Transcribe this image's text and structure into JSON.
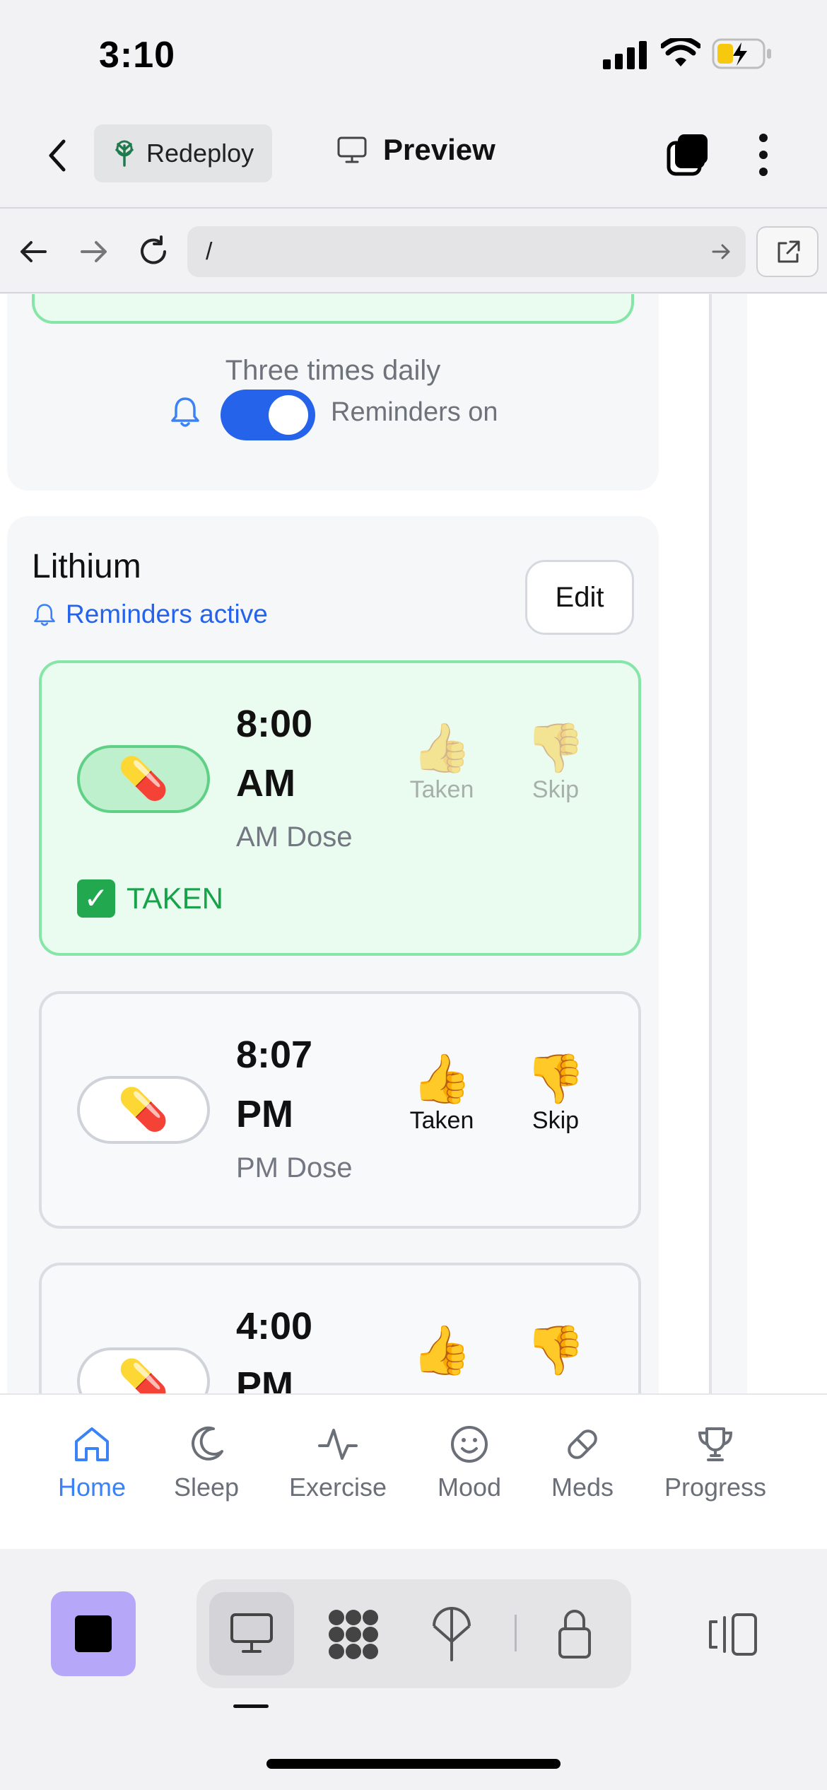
{
  "status_bar": {
    "time": "3:10"
  },
  "app_header": {
    "deploy_label": "Redeploy",
    "preview_label": "Preview"
  },
  "url_bar": {
    "path": "/"
  },
  "previous_card": {
    "frequency": "Three times daily",
    "reminder_label": "Reminders on"
  },
  "medication": {
    "name": "Lithium",
    "reminder_status": "Reminders active",
    "edit_label": "Edit",
    "doses": [
      {
        "time_line1": "8:00",
        "time_line2": "AM",
        "label": "AM Dose",
        "taken_label": "Taken",
        "skip_label": "Skip",
        "status": "TAKEN"
      },
      {
        "time_line1": "8:07",
        "time_line2": "PM",
        "label": "PM Dose",
        "taken_label": "Taken",
        "skip_label": "Skip"
      },
      {
        "time_line1": "4:00",
        "time_line2": "PM"
      }
    ]
  },
  "bottom_nav": {
    "items": [
      {
        "label": "Home",
        "icon": "home-icon",
        "active": true
      },
      {
        "label": "Sleep",
        "icon": "moon-icon"
      },
      {
        "label": "Exercise",
        "icon": "activity-icon"
      },
      {
        "label": "Mood",
        "icon": "smile-icon"
      },
      {
        "label": "Meds",
        "icon": "pill-icon"
      },
      {
        "label": "Progress",
        "icon": "trophy-icon"
      }
    ]
  },
  "colors": {
    "accent": "#3b82f6",
    "taken_green": "#16a34a",
    "taken_border": "#86e6a8",
    "toggle_blue": "#2563eb",
    "tool_square": "#b7a7f8"
  }
}
